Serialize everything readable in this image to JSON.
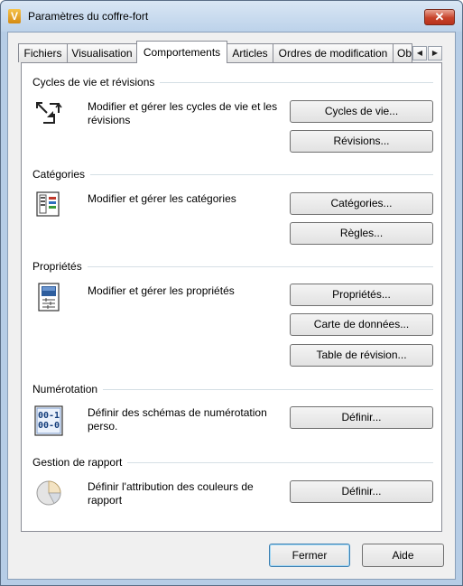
{
  "window": {
    "title": "Paramètres du coffre-fort",
    "app_icon_letter": "V",
    "close_glyph": "✕"
  },
  "tabs": [
    {
      "label": "Fichiers",
      "active": false
    },
    {
      "label": "Visualisation",
      "active": false
    },
    {
      "label": "Comportements",
      "active": true
    },
    {
      "label": "Articles",
      "active": false
    },
    {
      "label": "Ordres de modification",
      "active": false
    },
    {
      "label": "Ob",
      "active": false
    }
  ],
  "tab_scroll": {
    "left": "◀",
    "right": "▶"
  },
  "sections": {
    "lifecycle": {
      "title": "Cycles de vie et révisions",
      "description": "Modifier et gérer les cycles de vie et les révisions",
      "icon": "lifecycle-arrows-icon",
      "buttons": [
        "Cycles de vie...",
        "Révisions..."
      ]
    },
    "categories": {
      "title": "Catégories",
      "description": "Modifier et gérer les catégories",
      "icon": "categories-icon",
      "buttons": [
        "Catégories...",
        "Règles..."
      ]
    },
    "properties": {
      "title": "Propriétés",
      "description": "Modifier et gérer les propriétés",
      "icon": "properties-icon",
      "buttons": [
        "Propriétés...",
        "Carte de données...",
        "Table de révision..."
      ]
    },
    "numbering": {
      "title": "Numérotation",
      "description": "Définir des schémas de numérotation perso.",
      "icon": "numbering-icon",
      "icon_text": [
        "00-1",
        "00-0"
      ],
      "buttons": [
        "Définir..."
      ]
    },
    "report": {
      "title": "Gestion de rapport",
      "description": "Définir l'attribution des couleurs de rapport",
      "icon": "pie-chart-icon",
      "buttons": [
        "Définir..."
      ]
    }
  },
  "footer": {
    "close_label": "Fermer",
    "help_label": "Aide"
  },
  "colors": {
    "frame": "#b6cde6",
    "client": "#f0f0f0",
    "separator": "#d5dfe5",
    "default_button_border": "#3c7fb1"
  }
}
